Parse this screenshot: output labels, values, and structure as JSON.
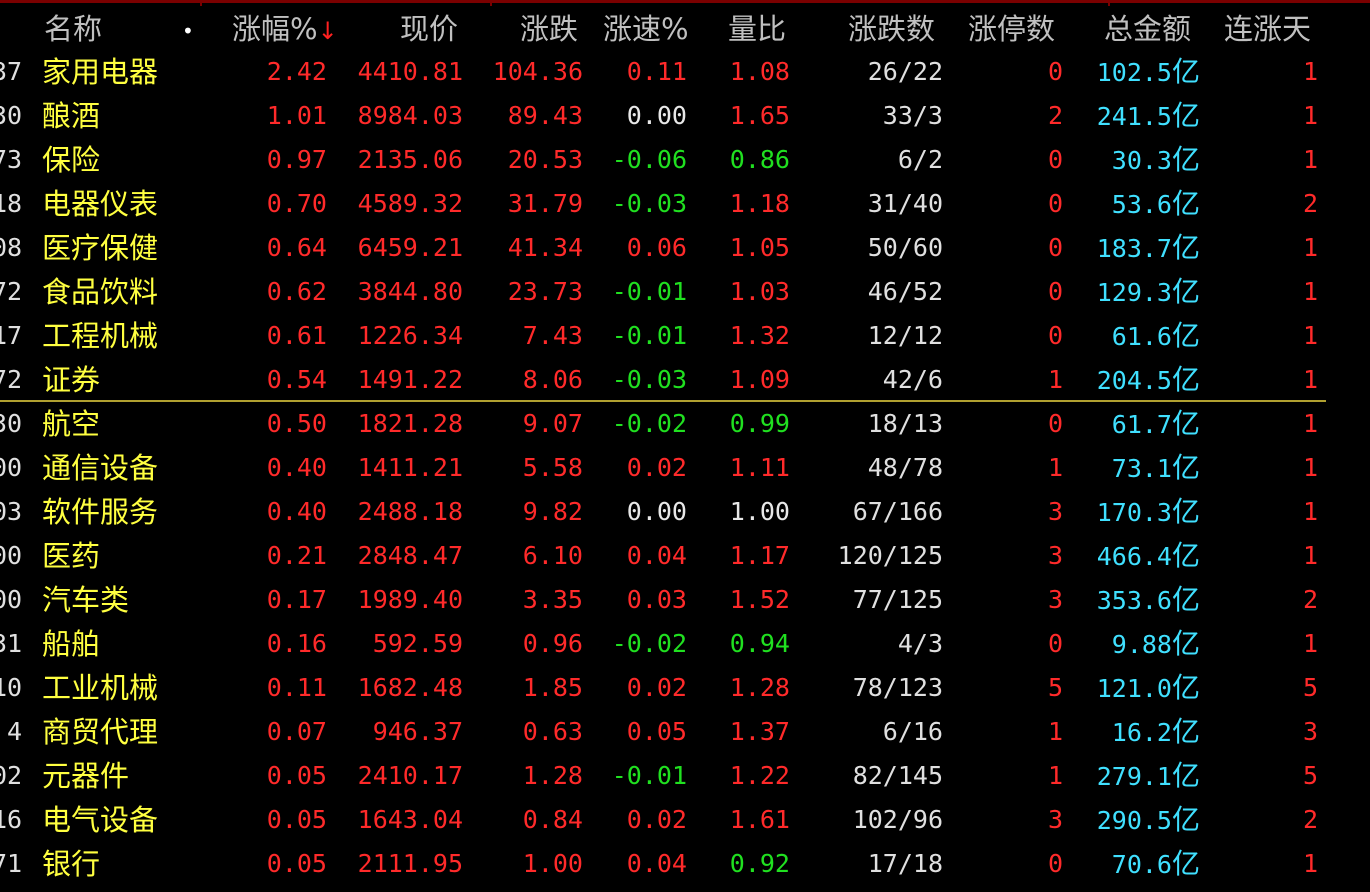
{
  "header": {
    "name": "名称",
    "dot": "•",
    "change_pct": "涨幅%",
    "sort_arrow": "↓",
    "price": "现价",
    "change": "涨跌",
    "speed": "涨速%",
    "volume_ratio": "量比",
    "up_down_count": "涨跌数",
    "limit_up_count": "涨停数",
    "total_amount": "总金额",
    "consecutive_days": "连涨天"
  },
  "colors": {
    "up": "#ff2a2a",
    "down": "#20e020",
    "flat": "#e8e8e8",
    "name": "#ffff40",
    "amount": "#40e0ff"
  },
  "rows": [
    {
      "code": "37",
      "name": "家用电器",
      "chg": "2.42",
      "price": "4410.81",
      "diff": "104.36",
      "speed": "0.11",
      "speed_c": "red",
      "vol": "1.08",
      "vol_c": "red",
      "updown": "26/22",
      "limit": "0",
      "limit_c": "red",
      "amount": "102.5",
      "unit": "亿",
      "days": "1"
    },
    {
      "code": "30",
      "name": "酿酒",
      "chg": "1.01",
      "price": "8984.03",
      "diff": "89.43",
      "speed": "0.00",
      "speed_c": "white",
      "vol": "1.65",
      "vol_c": "red",
      "updown": "33/3",
      "limit": "2",
      "limit_c": "red",
      "amount": "241.5",
      "unit": "亿",
      "days": "1"
    },
    {
      "code": "73",
      "name": "保险",
      "chg": "0.97",
      "price": "2135.06",
      "diff": "20.53",
      "speed": "-0.06",
      "speed_c": "green",
      "vol": "0.86",
      "vol_c": "green",
      "updown": "6/2",
      "limit": "0",
      "limit_c": "red",
      "amount": "30.3",
      "unit": "亿",
      "days": "1"
    },
    {
      "code": "18",
      "name": "电器仪表",
      "chg": "0.70",
      "price": "4589.32",
      "diff": "31.79",
      "speed": "-0.03",
      "speed_c": "green",
      "vol": "1.18",
      "vol_c": "red",
      "updown": "31/40",
      "limit": "0",
      "limit_c": "red",
      "amount": "53.6",
      "unit": "亿",
      "days": "2"
    },
    {
      "code": "08",
      "name": "医疗保健",
      "chg": "0.64",
      "price": "6459.21",
      "diff": "41.34",
      "speed": "0.06",
      "speed_c": "red",
      "vol": "1.05",
      "vol_c": "red",
      "updown": "50/60",
      "limit": "0",
      "limit_c": "red",
      "amount": "183.7",
      "unit": "亿",
      "days": "1"
    },
    {
      "code": "72",
      "name": "食品饮料",
      "chg": "0.62",
      "price": "3844.80",
      "diff": "23.73",
      "speed": "-0.01",
      "speed_c": "green",
      "vol": "1.03",
      "vol_c": "red",
      "updown": "46/52",
      "limit": "0",
      "limit_c": "red",
      "amount": "129.3",
      "unit": "亿",
      "days": "1"
    },
    {
      "code": "17",
      "name": "工程机械",
      "chg": "0.61",
      "price": "1226.34",
      "diff": "7.43",
      "speed": "-0.01",
      "speed_c": "green",
      "vol": "1.32",
      "vol_c": "red",
      "updown": "12/12",
      "limit": "0",
      "limit_c": "red",
      "amount": "61.6",
      "unit": "亿",
      "days": "1"
    },
    {
      "code": "72",
      "name": "证券",
      "chg": "0.54",
      "price": "1491.22",
      "diff": "8.06",
      "speed": "-0.03",
      "speed_c": "green",
      "vol": "1.09",
      "vol_c": "red",
      "updown": "42/6",
      "limit": "1",
      "limit_c": "red",
      "amount": "204.5",
      "unit": "亿",
      "days": "1"
    },
    {
      "code": "30",
      "name": "航空",
      "chg": "0.50",
      "price": "1821.28",
      "diff": "9.07",
      "speed": "-0.02",
      "speed_c": "green",
      "vol": "0.99",
      "vol_c": "green",
      "updown": "18/13",
      "limit": "0",
      "limit_c": "red",
      "amount": "61.7",
      "unit": "亿",
      "days": "1"
    },
    {
      "code": "00",
      "name": "通信设备",
      "chg": "0.40",
      "price": "1411.21",
      "diff": "5.58",
      "speed": "0.02",
      "speed_c": "red",
      "vol": "1.11",
      "vol_c": "red",
      "updown": "48/78",
      "limit": "1",
      "limit_c": "red",
      "amount": "73.1",
      "unit": "亿",
      "days": "1"
    },
    {
      "code": "03",
      "name": "软件服务",
      "chg": "0.40",
      "price": "2488.18",
      "diff": "9.82",
      "speed": "0.00",
      "speed_c": "white",
      "vol": "1.00",
      "vol_c": "white",
      "updown": "67/166",
      "limit": "3",
      "limit_c": "red",
      "amount": "170.3",
      "unit": "亿",
      "days": "1"
    },
    {
      "code": "00",
      "name": "医药",
      "chg": "0.21",
      "price": "2848.47",
      "diff": "6.10",
      "speed": "0.04",
      "speed_c": "red",
      "vol": "1.17",
      "vol_c": "red",
      "updown": "120/125",
      "limit": "3",
      "limit_c": "red",
      "amount": "466.4",
      "unit": "亿",
      "days": "1"
    },
    {
      "code": "00",
      "name": "汽车类",
      "chg": "0.17",
      "price": "1989.40",
      "diff": "3.35",
      "speed": "0.03",
      "speed_c": "red",
      "vol": "1.52",
      "vol_c": "red",
      "updown": "77/125",
      "limit": "3",
      "limit_c": "red",
      "amount": "353.6",
      "unit": "亿",
      "days": "2"
    },
    {
      "code": "31",
      "name": "船舶",
      "chg": "0.16",
      "price": "592.59",
      "diff": "0.96",
      "speed": "-0.02",
      "speed_c": "green",
      "vol": "0.94",
      "vol_c": "green",
      "updown": "4/3",
      "limit": "0",
      "limit_c": "red",
      "amount": "9.88",
      "unit": "亿",
      "days": "1"
    },
    {
      "code": "10",
      "name": "工业机械",
      "chg": "0.11",
      "price": "1682.48",
      "diff": "1.85",
      "speed": "0.02",
      "speed_c": "red",
      "vol": "1.28",
      "vol_c": "red",
      "updown": "78/123",
      "limit": "5",
      "limit_c": "red",
      "amount": "121.0",
      "unit": "亿",
      "days": "5"
    },
    {
      "code": "4",
      "name": "商贸代理",
      "chg": "0.07",
      "price": "946.37",
      "diff": "0.63",
      "speed": "0.05",
      "speed_c": "red",
      "vol": "1.37",
      "vol_c": "red",
      "updown": "6/16",
      "limit": "1",
      "limit_c": "red",
      "amount": "16.2",
      "unit": "亿",
      "days": "3"
    },
    {
      "code": "02",
      "name": "元器件",
      "chg": "0.05",
      "price": "2410.17",
      "diff": "1.28",
      "speed": "-0.01",
      "speed_c": "green",
      "vol": "1.22",
      "vol_c": "red",
      "updown": "82/145",
      "limit": "1",
      "limit_c": "red",
      "amount": "279.1",
      "unit": "亿",
      "days": "5"
    },
    {
      "code": "16",
      "name": "电气设备",
      "chg": "0.05",
      "price": "1643.04",
      "diff": "0.84",
      "speed": "0.02",
      "speed_c": "red",
      "vol": "1.61",
      "vol_c": "red",
      "updown": "102/96",
      "limit": "3",
      "limit_c": "red",
      "amount": "290.5",
      "unit": "亿",
      "days": "2"
    },
    {
      "code": "71",
      "name": "银行",
      "chg": "0.05",
      "price": "2111.95",
      "diff": "1.00",
      "speed": "0.04",
      "speed_c": "red",
      "vol": "0.92",
      "vol_c": "green",
      "updown": "17/18",
      "limit": "0",
      "limit_c": "red",
      "amount": "70.6",
      "unit": "亿",
      "days": "1"
    }
  ]
}
